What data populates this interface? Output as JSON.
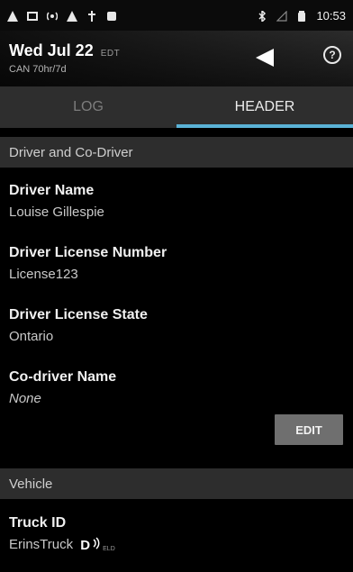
{
  "status_bar": {
    "left_icons": [
      "warning-icon",
      "square-icon",
      "signal-icon",
      "warning-icon",
      "tower-icon",
      "square-icon"
    ],
    "right_icons": [
      "bluetooth-icon",
      "signal-outline-icon",
      "battery-icon"
    ],
    "time": "10:53"
  },
  "header": {
    "date": "Wed Jul 22",
    "timezone": "EDT",
    "cycle": "CAN 70hr/7d",
    "help_symbol": "?"
  },
  "tabs": [
    {
      "label": "LOG",
      "active": false
    },
    {
      "label": "HEADER",
      "active": true
    }
  ],
  "sections": {
    "driver": {
      "title": "Driver and Co-Driver"
    },
    "vehicle": {
      "title": "Vehicle"
    }
  },
  "fields": {
    "driver_name": {
      "label": "Driver Name",
      "value": "Louise Gillespie"
    },
    "license_number": {
      "label": "Driver License Number",
      "value": "License123"
    },
    "license_state": {
      "label": "Driver License State",
      "value": "Ontario"
    },
    "codriver_name": {
      "label": "Co-driver Name",
      "value": "None"
    },
    "truck_id": {
      "label": "Truck ID",
      "value": "ErinsTruck",
      "badge_letter": "D",
      "badge_text": "ELD"
    }
  },
  "buttons": {
    "edit": "EDIT"
  },
  "colors": {
    "accent": "#5ab2d6",
    "section_bg": "#2d2d2d",
    "background": "#000000"
  }
}
